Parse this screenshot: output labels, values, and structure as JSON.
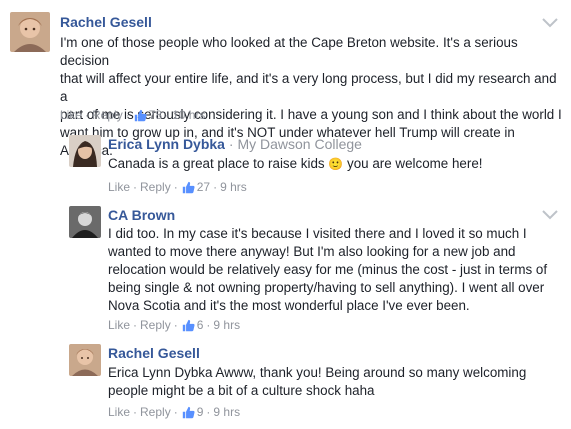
{
  "comments": [
    {
      "author": "Rachel Gesell",
      "affiliation": "",
      "lines": [
        "I'm one of those people who looked at the Cape Breton website. It's a serious decision",
        "that will affect your entire life, and it's a very long process, but I did my research and a",
        "part of me is seriously considering it. I have a young son and I think about the world I",
        "want him to grow up in, and it's NOT under whatever hell Trump will create in America."
      ],
      "like": "Like",
      "reply": "Reply",
      "likes": "78",
      "time": "10 hrs"
    },
    {
      "author": "Erica Lynn Dybka",
      "affiliation": "My Dawson College",
      "lines": [
        "Canada is a great place to raise kids",
        "you are welcome here!"
      ],
      "emoji": "🙂",
      "like": "Like",
      "reply": "Reply",
      "likes": "27",
      "time": "9 hrs"
    },
    {
      "author": "CA Brown",
      "affiliation": "",
      "lines": [
        "I did too. In my case it's because I visited there and I loved it so much I",
        "wanted to move there anyway! But I'm also looking for a new job and",
        "relocation would be relatively easy for me (minus the cost - just in terms of",
        "being single & not owning property/having to sell anything). I went all over",
        "Nova Scotia and it's the most wonderful place I've ever been."
      ],
      "like": "Like",
      "reply": "Reply",
      "likes": "6",
      "time": "9 hrs"
    },
    {
      "author": "Rachel Gesell",
      "affiliation": "",
      "lines": [
        "Erica Lynn Dybka Awww, thank you! Being around so many welcoming",
        "people might be a bit of a culture shock haha"
      ],
      "like": "Like",
      "reply": "Reply",
      "likes": "9",
      "time": "9 hrs"
    }
  ],
  "colors": {
    "name": "#365899",
    "meta": "#90949c",
    "text": "#1d2129",
    "thumb": "#5890ff"
  },
  "icons": [
    "thumbs-up-icon",
    "chevron-down-icon",
    "smiley-emoji"
  ]
}
